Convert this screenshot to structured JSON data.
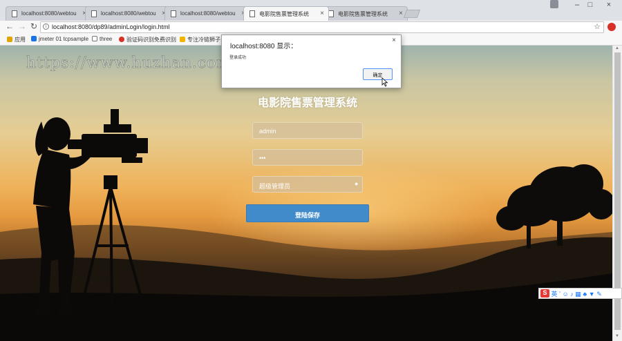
{
  "browser": {
    "tabs": [
      {
        "label": "localhost:8080/webtou",
        "active": false
      },
      {
        "label": "localhost:8080/webtou",
        "active": false
      },
      {
        "label": "localhost:8080/webtou",
        "active": false
      },
      {
        "label": "电影院售票管理系统",
        "active": true
      },
      {
        "label": "电影院售票管理系统",
        "active": false
      }
    ],
    "url": "localhost:8080/dp89/adminLogin/login.html",
    "bookmarks": [
      {
        "label": "应用",
        "icon": "apps-grid-icon",
        "color": "#e0a400"
      },
      {
        "label": "jmeter 01 tcpsample",
        "icon": "shield-bookmark-icon",
        "color": "#1a73e8"
      },
      {
        "label": "three",
        "icon": "page-bookmark-icon",
        "color": "#ffffff"
      },
      {
        "label": "验证码识别免费识别",
        "icon": "red-bookmark-icon",
        "color": "#d93025"
      },
      {
        "label": "专注冷链狮子",
        "icon": "hand-bookmark-icon",
        "color": "#f2b400"
      }
    ]
  },
  "watermark": "https://www.huzhan.com/ishop39397",
  "login": {
    "title": "电影院售票管理系统",
    "username_value": "admin",
    "password_value": "•••",
    "role_selected": "超级管理员",
    "submit_label": "登陆保存"
  },
  "dialog": {
    "title": "localhost:8080 显示：",
    "message": "登录成功",
    "ok_label": "确定"
  },
  "ime": {
    "mode_label": "英"
  },
  "colors": {
    "login_button": "#428bca",
    "dialog_focus": "#4d90fe"
  }
}
